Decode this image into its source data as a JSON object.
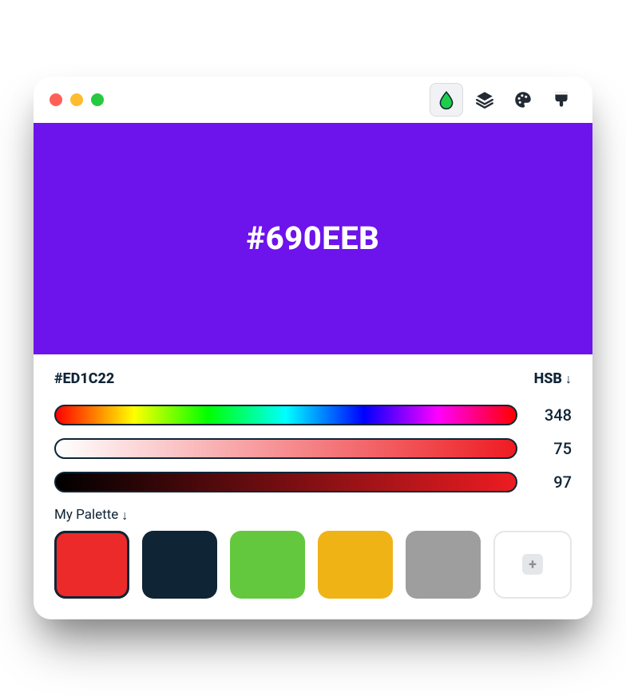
{
  "traffic": {
    "red": "#ff5f57",
    "yellow": "#febc2e",
    "green": "#28c840"
  },
  "toolbar": {
    "drop_icon_color": "#1fce4a",
    "icon_color": "#222a33"
  },
  "preview": {
    "hex_label": "#690EEB",
    "background": "#6d13ec"
  },
  "current_hex": "#ED1C22",
  "mode_label": "HSB",
  "sliders": {
    "hue_value": "348",
    "sat_value": "75",
    "bri_value": "97",
    "hue_bg": "linear-gradient(90deg,#ff0000 0%,#ffff00 17%,#00ff00 33%,#00ffff 50%,#0000ff 67%,#ff00ff 83%,#ff0000 100%)",
    "sat_bg": "linear-gradient(90deg,#ffffff 0%,#ed1c22 100%)",
    "bri_bg": "linear-gradient(90deg,#000000 0%,#ed1c22 100%)"
  },
  "palette_label": "My Palette",
  "palette": {
    "colors": [
      "#ed2a2a",
      "#0f2435",
      "#63c83e",
      "#f0b316",
      "#9e9e9e"
    ]
  }
}
